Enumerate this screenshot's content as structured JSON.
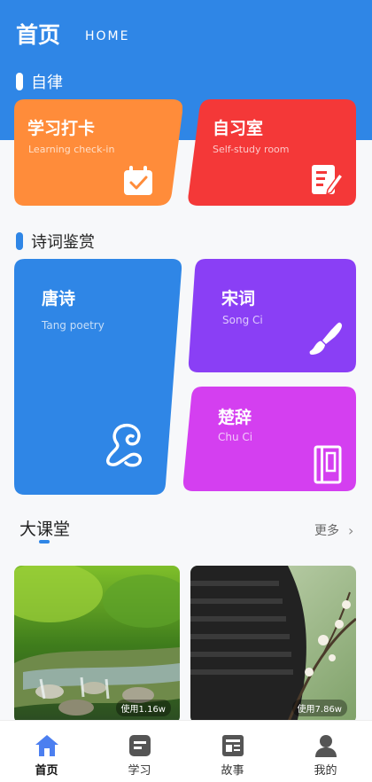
{
  "header": {
    "title": "首页",
    "subtitle": "HOME",
    "color": "#2f86e6"
  },
  "section_discipline": {
    "title": "自律"
  },
  "cards_top": [
    {
      "title": "学习打卡",
      "en": "Learning check-in",
      "color": "#ff8c3a",
      "icon": "calendar-check-icon"
    },
    {
      "title": "自习室",
      "en": "Self-study room",
      "color": "#f43838",
      "icon": "note-pen-icon"
    }
  ],
  "section_poetry": {
    "title": "诗词鉴赏"
  },
  "cards_poetry": [
    {
      "title": "唐诗",
      "en": "Tang poetry",
      "color": "#2f86e6",
      "icon": "jade-ornament-icon"
    },
    {
      "title": "宋词",
      "en": "Song Ci",
      "color": "#8a3ff5",
      "icon": "brush-icon"
    },
    {
      "title": "楚辞",
      "en": "Chu Ci",
      "color": "#d43ff0",
      "icon": "book-icon"
    }
  ],
  "lectures": {
    "title": "大课堂",
    "more": "更多",
    "items": [
      {
        "usage": "使用1.16w",
        "scene": "forest-stream"
      },
      {
        "usage": "使用7.86w",
        "scene": "plum-blossom-roof"
      }
    ]
  },
  "tabbar": {
    "items": [
      {
        "label": "首页",
        "icon": "home-icon",
        "active": true,
        "color": "#4c7ff0"
      },
      {
        "label": "学习",
        "icon": "notebook-icon",
        "active": false,
        "color": "#555"
      },
      {
        "label": "故事",
        "icon": "newspaper-icon",
        "active": false,
        "color": "#555"
      },
      {
        "label": "我的",
        "icon": "user-icon",
        "active": false,
        "color": "#555"
      }
    ]
  }
}
